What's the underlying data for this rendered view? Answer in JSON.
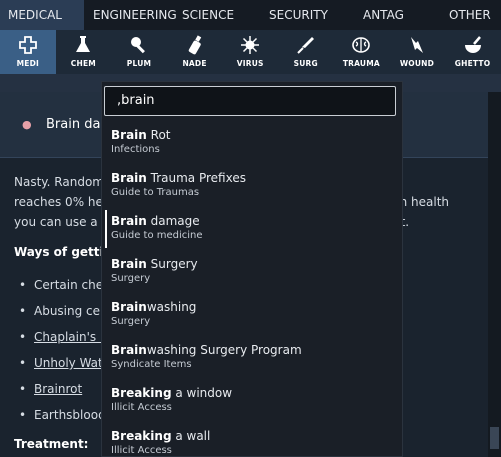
{
  "categories": [
    {
      "label": "MEDICAL",
      "active": true
    },
    {
      "label": "ENGINEERING",
      "active": false
    },
    {
      "label": "SCIENCE",
      "active": false
    },
    {
      "label": "SECURITY",
      "active": false
    },
    {
      "label": "ANTAG",
      "active": false
    },
    {
      "label": "OTHER",
      "active": false
    }
  ],
  "subtabs": [
    {
      "label": "MEDI",
      "icon": "medical-cross-icon",
      "active": true
    },
    {
      "label": "CHEM",
      "icon": "flask-icon",
      "active": false
    },
    {
      "label": "PLUM",
      "icon": "plunger-icon",
      "active": false
    },
    {
      "label": "NADE",
      "icon": "grenade-icon",
      "active": false
    },
    {
      "label": "VIRUS",
      "icon": "virus-icon",
      "active": false
    },
    {
      "label": "SURG",
      "icon": "scalpel-icon",
      "active": false
    },
    {
      "label": "TRAUMA",
      "icon": "brain-icon",
      "active": false
    },
    {
      "label": "WOUND",
      "icon": "wound-icon",
      "active": false
    },
    {
      "label": "GHETTO",
      "icon": "mortar-pestle-icon",
      "active": false
    }
  ],
  "page": {
    "title": "Brain damage",
    "icon": "brain-icon",
    "intro_lines": [
      "Nasty. Randomly ... and other problems. If a brain",
      "reaches 0% health, the person dies. To be able to see exact brain health",
      "you can use a ... health analyzer; the CMO gets one of by default."
    ],
    "ways_heading": "Ways of getting damaged:",
    "ways": [
      "Certain chem... such as mercury, impedrezene, or fentanyl",
      "Abusing cert...",
      "Chaplain's bible applied to the head.",
      "Unholy Water",
      "Brainrot",
      "Earthsblood ... Gaia."
    ],
    "treatment_heading": "Treatment:"
  },
  "search": {
    "value": ",brain"
  },
  "results": [
    {
      "title_match": "Brain",
      "title_rest": " Rot",
      "subtitle": "Infections",
      "selected": false
    },
    {
      "title_match": "Brain",
      "title_rest": " Trauma Prefixes",
      "subtitle": "Guide to Traumas",
      "selected": false
    },
    {
      "title_match": "Brain",
      "title_rest": " damage",
      "subtitle": "Guide to medicine",
      "selected": true
    },
    {
      "title_match": "Brain",
      "title_rest": " Surgery",
      "subtitle": "Surgery",
      "selected": false
    },
    {
      "title_match": "Brain",
      "title_rest": "washing",
      "subtitle": "Surgery",
      "selected": false
    },
    {
      "title_match": "Brain",
      "title_rest": "washing Surgery Program",
      "subtitle": "Syndicate Items",
      "selected": false
    },
    {
      "title_match": "Breaking",
      "title_rest": " a window",
      "subtitle": "Illicit Access",
      "selected": false
    },
    {
      "title_match": "Breaking",
      "title_rest": " a wall",
      "subtitle": "Illicit Access",
      "selected": false
    }
  ],
  "colors": {
    "active_category": "#2b3d55",
    "active_subtab": "#3a5f86",
    "background": "#1b2430"
  }
}
